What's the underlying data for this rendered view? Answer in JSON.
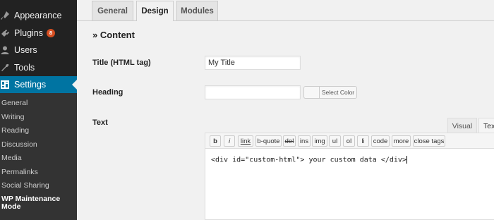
{
  "sidebar": {
    "menu": [
      {
        "label": "Appearance",
        "icon": "paintbrush-icon"
      },
      {
        "label": "Plugins",
        "icon": "plugin-icon",
        "badge": "8"
      },
      {
        "label": "Users",
        "icon": "user-icon"
      },
      {
        "label": "Tools",
        "icon": "wrench-icon"
      },
      {
        "label": "Settings",
        "icon": "settings-icon",
        "active": true
      }
    ],
    "submenu": [
      {
        "label": "General"
      },
      {
        "label": "Writing"
      },
      {
        "label": "Reading"
      },
      {
        "label": "Discussion"
      },
      {
        "label": "Media"
      },
      {
        "label": "Permalinks"
      },
      {
        "label": "Social Sharing"
      },
      {
        "label": "WP Maintenance Mode",
        "current": true
      }
    ]
  },
  "tabs": [
    {
      "label": "General"
    },
    {
      "label": "Design",
      "active": true
    },
    {
      "label": "Modules"
    }
  ],
  "section": {
    "title": "» Content"
  },
  "fields": {
    "title": {
      "label": "Title (HTML tag)",
      "value": "My Title"
    },
    "heading": {
      "label": "Heading",
      "value": "",
      "color_button": "Select Color"
    },
    "text": {
      "label": "Text",
      "tab_visual": "Visual",
      "tab_text": "Text",
      "toolbar": [
        "b",
        "i",
        "link",
        "b-quote",
        "del",
        "ins",
        "img",
        "ul",
        "ol",
        "li",
        "code",
        "more",
        "close tags"
      ],
      "content": "<div id=\"custom-html\"> your custom data </div>"
    }
  },
  "colors": {
    "sidebar_bg": "#222222",
    "submenu_bg": "#333333",
    "active_menu": "#0074a2",
    "badge": "#d54e21",
    "page_bg": "#f1f1f1"
  }
}
